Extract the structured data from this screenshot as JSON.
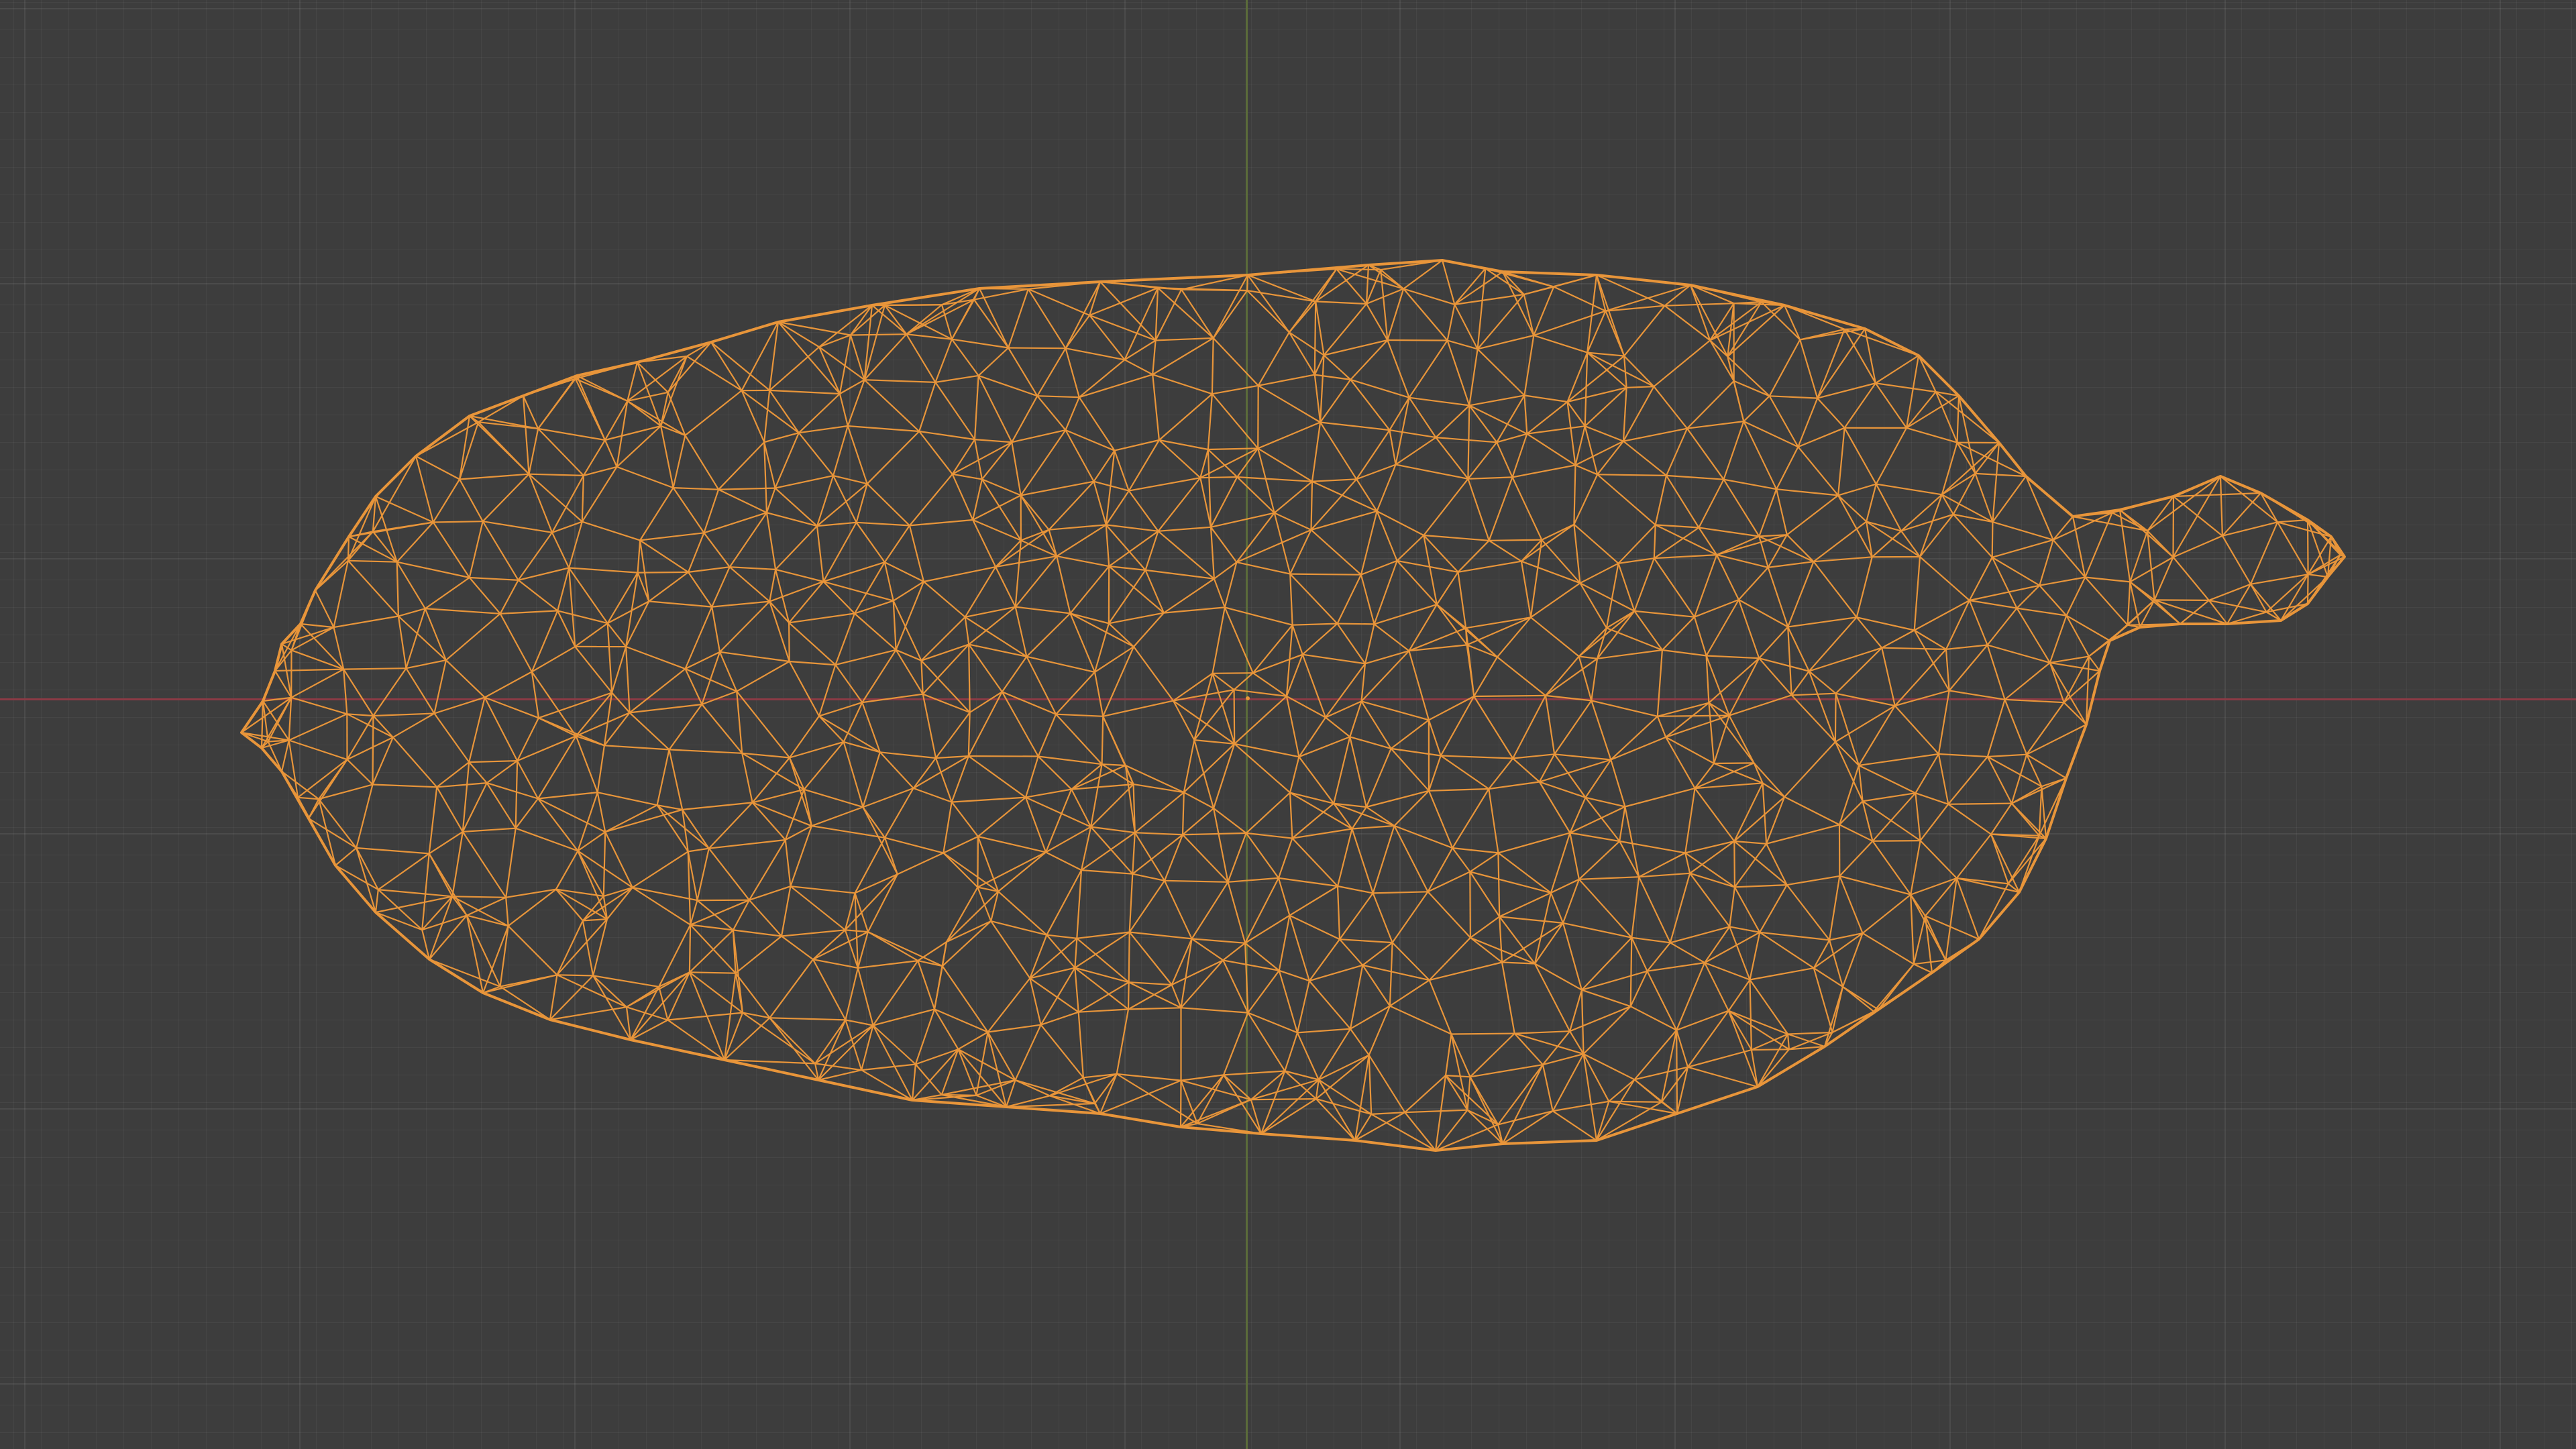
{
  "viewport": {
    "background_color": "#3d3d3d",
    "grid_color": "#474747",
    "x_axis_color": "#8a3a45",
    "y_axis_color": "#5b6b3a"
  },
  "mesh": {
    "object": "wireframe-mesh",
    "edge_color": "#e8953a",
    "display_mode": "wireframe"
  }
}
